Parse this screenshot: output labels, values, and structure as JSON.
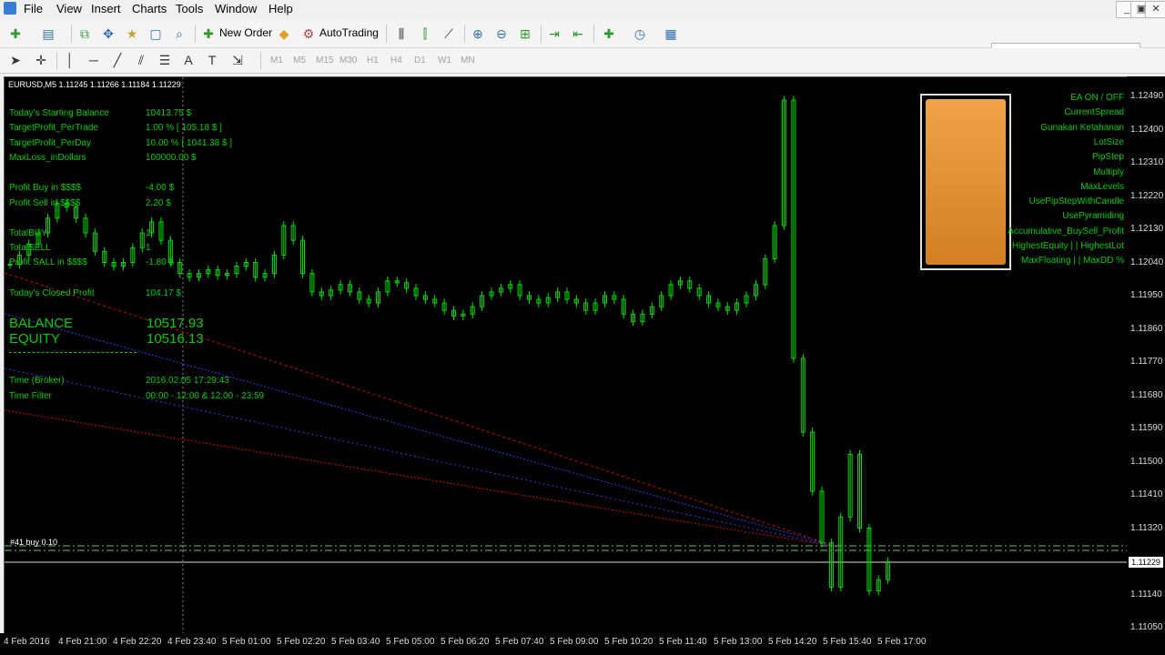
{
  "menu": [
    "File",
    "View",
    "Insert",
    "Charts",
    "Tools",
    "Window",
    "Help"
  ],
  "window_controls": [
    "_",
    "▣",
    "✕"
  ],
  "toolbar": {
    "new_order": "New Order",
    "auto_trading": "AutoTrading"
  },
  "timeframes": [
    "M1",
    "M5",
    "M15",
    "M30",
    "H1",
    "H4",
    "D1",
    "W1",
    "MN"
  ],
  "chart": {
    "symbol_line": "EURUSD,M5  1.11245 1.11266 1.11184 1.11229",
    "info_labels": [
      "Today's Starting Balance",
      "TargetProfit_PerTrade",
      "TargetProfit_PerDay",
      "MaxLoss_inDollars",
      "Profit Buy in $$$$",
      "Profit Sell in $$$$",
      "TotalBUY",
      "TotalSELL",
      "Profit SALL in $$$$",
      "Today's Closed Profit"
    ],
    "info_values": [
      "10413.75 $",
      "1.00 % [ 105.18 $ ]",
      "10.00 % [ 1041.38 $ ]",
      "100000.00 $",
      "-4.00 $",
      "2.20 $",
      "1",
      "1",
      "-1.80 $",
      "104.17 $"
    ],
    "balance_label": "BALANCE",
    "balance_value": "10517.93",
    "equity_label": "EQUITY",
    "equity_value": "10516.13",
    "time_broker_label": "Time (Broker)",
    "time_broker_value": "2016.02.05 17:29:43",
    "time_filter_label": "Time Filter",
    "time_filter_value": "00:00 - 12:00 & 12:00 - 23:59",
    "order_tag": "#41 buy 0.10",
    "right_panel": [
      "EA ON / OFF",
      "CurrentSpread",
      "Gunakan Ketahanan",
      "LotSize",
      "PipStep",
      "Multiply",
      "MaxLevels",
      "UsePipStepWithCandle",
      "UsePyramiding",
      "Accumulative_BuySell_Profit",
      "HighestEquity | | HighestLot",
      "MaxFloating | |  MaxDD %"
    ],
    "y_axis": [
      "1.12490",
      "1.12400",
      "1.12310",
      "1.12220",
      "1.12130",
      "1.12040",
      "1.11950",
      "1.11860",
      "1.11770",
      "1.11680",
      "1.11590",
      "1.11500",
      "1.11410",
      "1.11320",
      "1.11229",
      "1.11140",
      "1.11050"
    ],
    "x_axis": [
      "4 Feb 2016",
      "4 Feb 21:00",
      "4 Feb 22:20",
      "4 Feb 23:40",
      "5 Feb 01:00",
      "5 Feb 02:20",
      "5 Feb 03:40",
      "5 Feb 05:00",
      "5 Feb 06:20",
      "5 Feb 07:40",
      "5 Feb 09:00",
      "5 Feb 10:20",
      "5 Feb 11:40",
      "5 Feb 13:00",
      "5 Feb 14:20",
      "5 Feb 15:40",
      "5 Feb 17:00"
    ],
    "current_price": "1.11229",
    "price_series": [
      1.12035,
      1.1206,
      1.1209,
      1.1212,
      1.1216,
      1.122,
      1.1219,
      1.1216,
      1.1212,
      1.1207,
      1.1204,
      1.1203,
      1.1204,
      1.1208,
      1.1212,
      1.1215,
      1.121,
      1.1204,
      1.1201,
      1.12,
      1.1201,
      1.1202,
      1.12005,
      1.1201,
      1.1203,
      1.1204,
      1.12,
      1.1201,
      1.1206,
      1.1214,
      1.121,
      1.1201,
      1.1196,
      1.1195,
      1.11965,
      1.1198,
      1.1196,
      1.1194,
      1.1193,
      1.1196,
      1.1199,
      1.11985,
      1.1197,
      1.1195,
      1.1194,
      1.1193,
      1.1191,
      1.11895,
      1.119,
      1.1192,
      1.1195,
      1.1196,
      1.1197,
      1.1198,
      1.1195,
      1.1194,
      1.1193,
      1.11945,
      1.1196,
      1.1194,
      1.1193,
      1.1191,
      1.1193,
      1.1195,
      1.1194,
      1.119,
      1.1188,
      1.119,
      1.1192,
      1.1195,
      1.1198,
      1.1199,
      1.1197,
      1.1195,
      1.1193,
      1.1192,
      1.1191,
      1.1193,
      1.1195,
      1.1198,
      1.1205,
      1.1214,
      1.1248,
      1.1178,
      1.1158,
      1.1142,
      1.1128,
      1.1116,
      1.1135,
      1.1152,
      1.1132,
      1.1115,
      1.1118,
      1.11229
    ]
  },
  "colors": {
    "bull": "#00e000",
    "text": "#00d000",
    "trend_red": "#e00000",
    "trend_blue": "#3333ff",
    "accent_orange": "#e8953a"
  }
}
